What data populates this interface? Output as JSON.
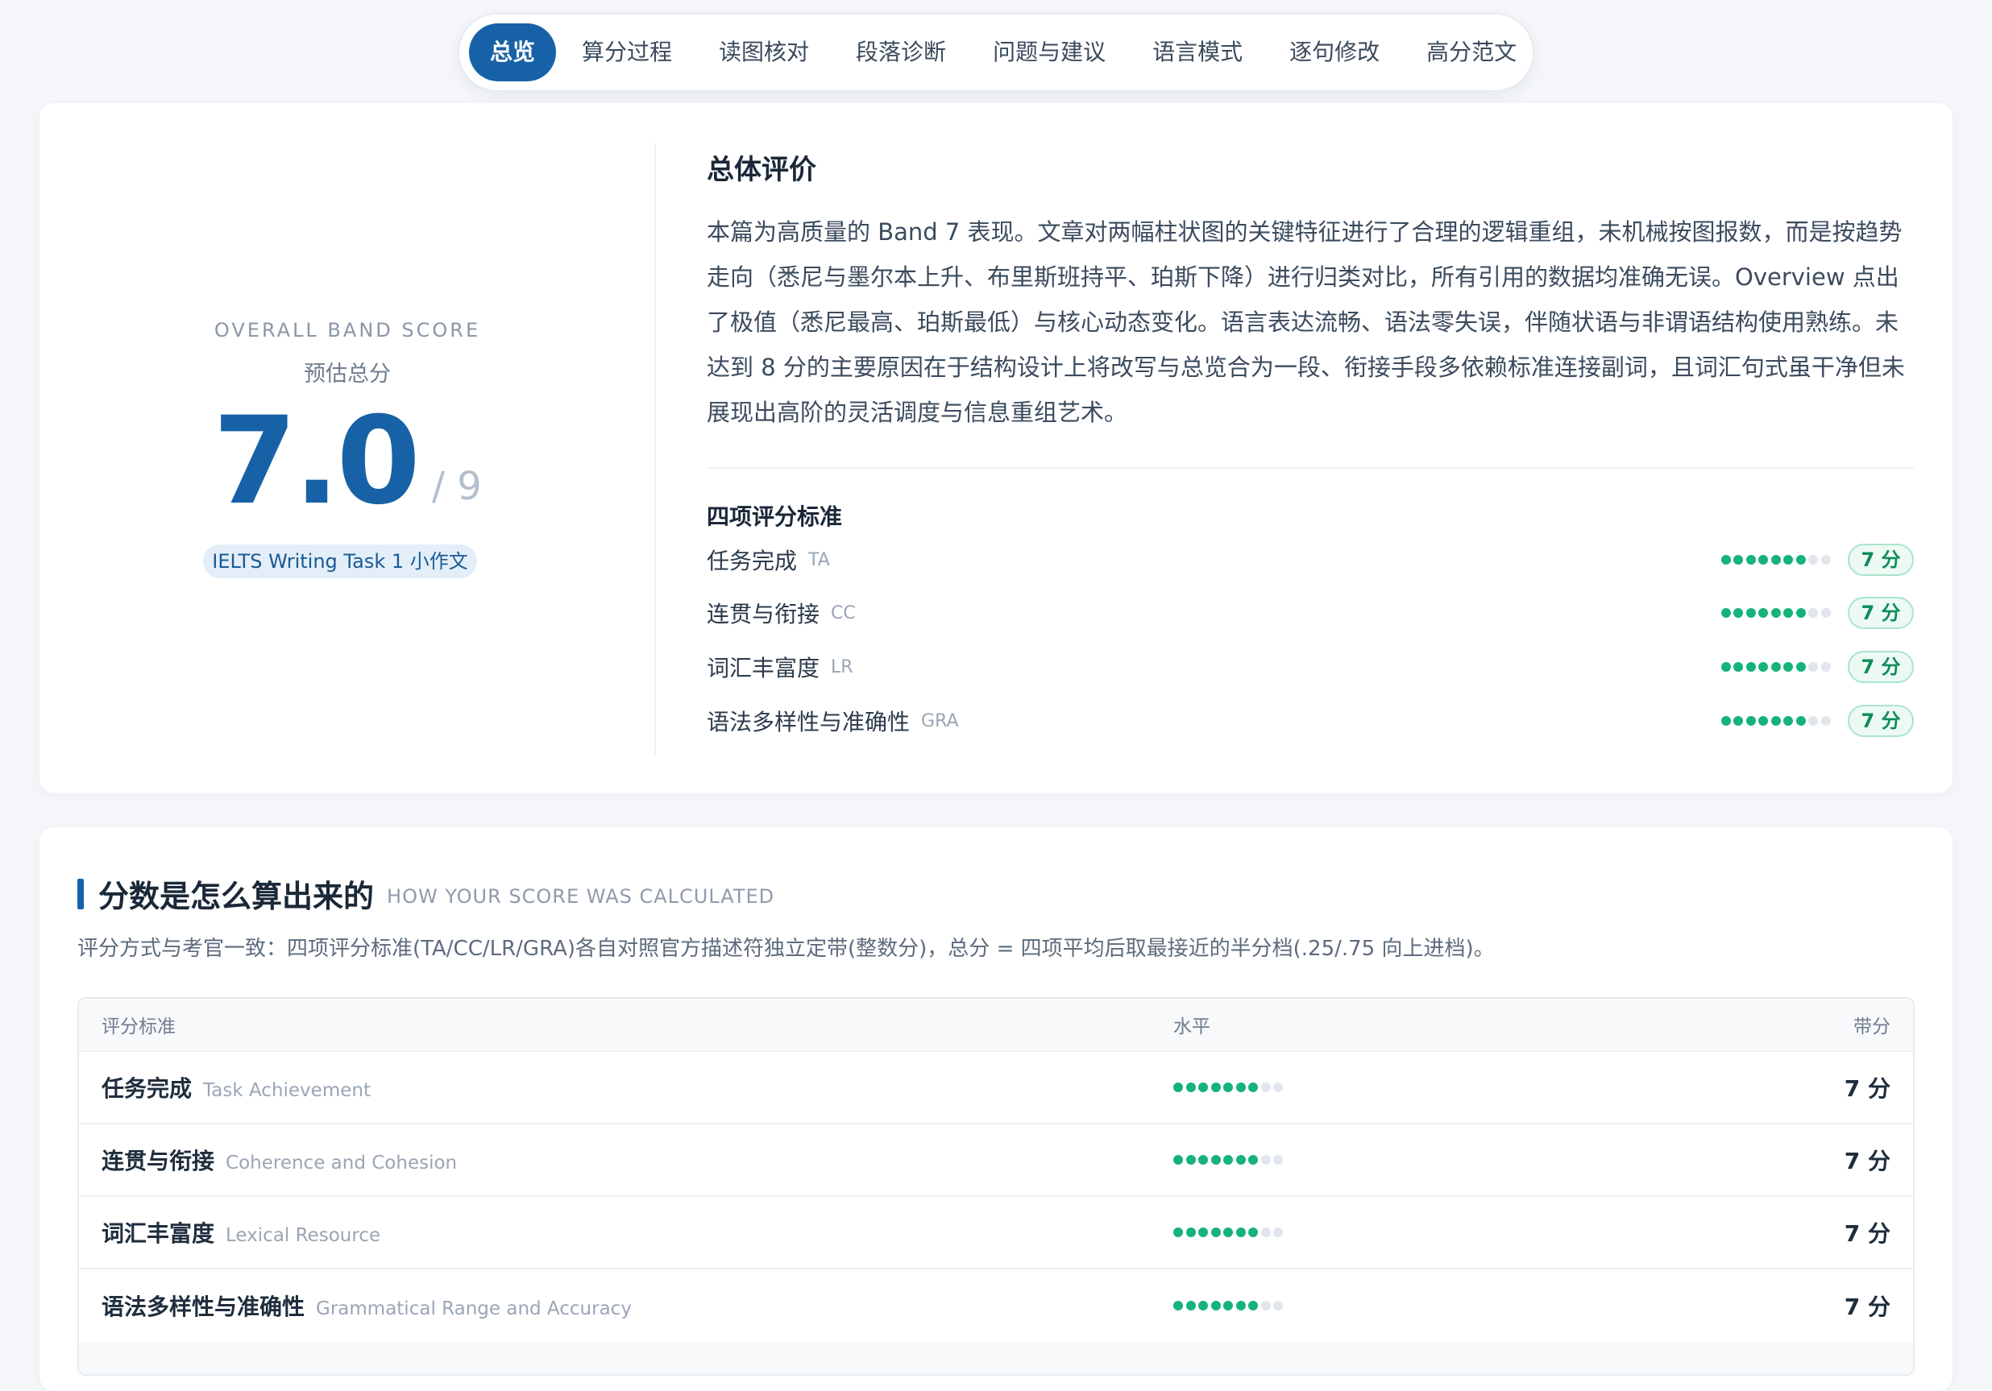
{
  "nav": {
    "tabs": [
      {
        "label": "总览",
        "active": true
      },
      {
        "label": "算分过程"
      },
      {
        "label": "读图核对"
      },
      {
        "label": "段落诊断"
      },
      {
        "label": "问题与建议"
      },
      {
        "label": "语言模式"
      },
      {
        "label": "逐句修改"
      },
      {
        "label": "高分范文"
      }
    ]
  },
  "score": {
    "label_en": "OVERALL BAND SCORE",
    "label_cn": "预估总分",
    "value": "7.0",
    "max": "/ 9",
    "tag": "IELTS Writing Task 1 小作文"
  },
  "evaluation": {
    "title": "总体评价",
    "body": "本篇为高质量的 Band 7 表现。文章对两幅柱状图的关键特征进行了合理的逻辑重组，未机械按图报数，而是按趋势走向（悉尼与墨尔本上升、布里斯班持平、珀斯下降）进行归类对比，所有引用的数据均准确无误。Overview 点出了极值（悉尼最高、珀斯最低）与核心动态变化。语言表达流畅、语法零失误，伴随状语与非谓语结构使用熟练。未达到 8 分的主要原因在于结构设计上将改写与总览合为一段、衔接手段多依赖标准连接副词，且词汇句式虽干净但未展现出高阶的灵活调度与信息重组艺术。"
  },
  "criteria": {
    "title": "四项评分标准",
    "max_dots": 9,
    "items": [
      {
        "name": "任务完成",
        "abbr": "TA",
        "band": 7,
        "badge": "7 分"
      },
      {
        "name": "连贯与衔接",
        "abbr": "CC",
        "band": 7,
        "badge": "7 分"
      },
      {
        "name": "词汇丰富度",
        "abbr": "LR",
        "band": 7,
        "badge": "7 分"
      },
      {
        "name": "语法多样性与准确性",
        "abbr": "GRA",
        "band": 7,
        "badge": "7 分"
      }
    ]
  },
  "calculation": {
    "title": "分数是怎么算出来的",
    "subtitle": "HOW YOUR SCORE WAS CALCULATED",
    "description": "评分方式与考官一致：四项评分标准(TA/CC/LR/GRA)各自对照官方描述符独立定带(整数分)，总分 = 四项平均后取最接近的半分档(.25/.75 向上进档)。",
    "table": {
      "headers": [
        "评分标准",
        "水平",
        "带分"
      ],
      "rows": [
        {
          "cn": "任务完成",
          "en": "Task Achievement",
          "band": 7,
          "band_label": "7 分"
        },
        {
          "cn": "连贯与衔接",
          "en": "Coherence and Cohesion",
          "band": 7,
          "band_label": "7 分"
        },
        {
          "cn": "词汇丰富度",
          "en": "Lexical Resource",
          "band": 7,
          "band_label": "7 分"
        },
        {
          "cn": "语法多样性与准确性",
          "en": "Grammatical Range and Accuracy",
          "band": 7,
          "band_label": "7 分"
        }
      ]
    }
  },
  "colors": {
    "primary": "#1762a6",
    "success": "#15b37a",
    "dot_off": "#e1e6ec"
  }
}
